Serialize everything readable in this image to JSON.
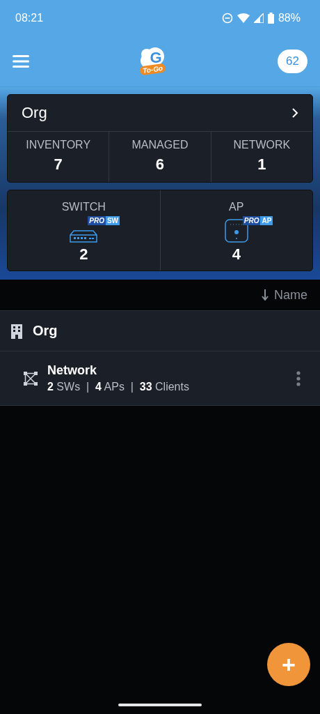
{
  "status_bar": {
    "time": "08:21",
    "battery": "88%"
  },
  "header": {
    "logo": {
      "letter": "G",
      "tagline": "To-Go"
    },
    "count": "62"
  },
  "org_card": {
    "title": "Org",
    "stats": [
      {
        "label": "INVENTORY",
        "value": "7"
      },
      {
        "label": "MANAGED",
        "value": "6"
      },
      {
        "label": "NETWORK",
        "value": "1"
      }
    ]
  },
  "device_card": [
    {
      "kind": "switch",
      "label": "SWITCH",
      "badge_pro": "PRO",
      "badge_type": "SW",
      "value": "2"
    },
    {
      "kind": "ap",
      "label": "AP",
      "badge_pro": "PRO",
      "badge_type": "AP",
      "value": "4"
    }
  ],
  "sort": {
    "label": "Name"
  },
  "org_row": {
    "name": "Org"
  },
  "networks": [
    {
      "name": "Network",
      "summary": "**2** SWs  |  **4** APs  |  **33** Clients"
    }
  ],
  "fab": {
    "label": "+"
  }
}
